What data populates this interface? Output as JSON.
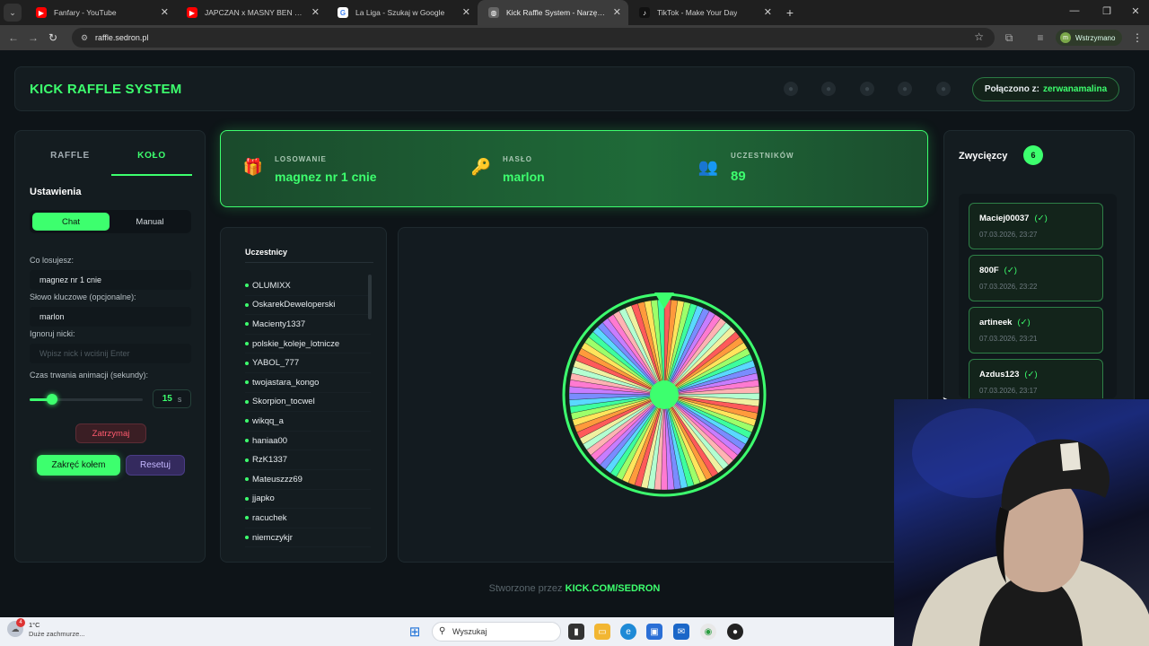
{
  "browser": {
    "tabs": [
      {
        "title": "Fanfary - YouTube",
        "icon": "youtube-icon",
        "color": "#ff0000"
      },
      {
        "title": "JAPCZAN x MASNY BEN - SHA",
        "icon": "youtube-icon",
        "color": "#ff0000"
      },
      {
        "title": "La Liga - Szukaj w Google",
        "icon": "google-icon",
        "color": "#ffffff"
      },
      {
        "title": "Kick Raffle System - Narzędzie d",
        "icon": "globe-icon",
        "color": "#777777"
      },
      {
        "title": "TikTok - Make Your Day",
        "icon": "tiktok-icon",
        "color": "#000000"
      }
    ],
    "active_tab": 3,
    "url": "raffle.sedron.pl",
    "profile_initial": "m",
    "profile_label": "Wstrzymano"
  },
  "header": {
    "brand": "KICK RAFFLE SYSTEM",
    "connected_label": "Połączono z:",
    "connected_user": "zerwanamalina"
  },
  "settings": {
    "tabs": [
      "RAFFLE",
      "KOŁO"
    ],
    "active_tab": "KOŁO",
    "title": "Ustawienia",
    "mode_options": [
      "Chat",
      "Manual"
    ],
    "mode_selected": "Chat",
    "prize_label": "Co losujesz:",
    "prize_value": "magnez nr 1 cnie",
    "keyword_label": "Słowo kluczowe (opcjonalne):",
    "keyword_value": "marlon",
    "ignore_label": "Ignoruj nicki:",
    "ignore_placeholder": "Wpisz nick i wciśnij Enter",
    "duration_label": "Czas trwania animacji (sekundy):",
    "duration_value": "15",
    "duration_unit": "s",
    "duration_fraction": 0.2,
    "stop_label": "Zatrzymaj",
    "spin_label": "Zakręć kołem",
    "reset_label": "Resetuj"
  },
  "info": {
    "draw_label": "LOSOWANIE",
    "draw_value": "magnez nr 1 cnie",
    "password_label": "HASŁO",
    "password_value": "marlon",
    "participants_label": "UCZESTNIKÓW",
    "participants_value": "89"
  },
  "participants": {
    "title": "Uczestnicy",
    "names": [
      "OLUMIXX",
      "OskarekDeweloperski",
      "Macienty1337",
      "polskie_koleje_lotnicze",
      "YABOL_777",
      "twojastara_kongo",
      "Skorpion_tocwel",
      "wikqq_a",
      "haniaa00",
      "RzK1337",
      "Mateuszzz69",
      "jjapko",
      "racuchek",
      "niemczykjr"
    ]
  },
  "wheel": {
    "segments": 89,
    "palette": [
      "#ff5a5a",
      "#ff9a3c",
      "#ffe45c",
      "#9dff6a",
      "#3dff9e",
      "#5ad8ff",
      "#7a8cff",
      "#c77dff",
      "#ff7ad1",
      "#ffb3b3",
      "#b3ffd1",
      "#f0f0a0"
    ]
  },
  "winners": {
    "title": "Zwycięzcy",
    "count": "6",
    "items": [
      {
        "name": "Maciej00037",
        "check": "(✓)",
        "time": "07.03.2026, 23:27"
      },
      {
        "name": "800F",
        "check": "(✓)",
        "time": "07.03.2026, 23:22"
      },
      {
        "name": "artineek",
        "check": "(✓)",
        "time": "07.03.2026, 23:21"
      },
      {
        "name": "Azdus123",
        "check": "(✓)",
        "time": "07.03.2026, 23:17"
      }
    ]
  },
  "footer": {
    "prefix": "Stworzone przez",
    "link": "KICK.COM/SEDRON"
  },
  "taskbar": {
    "weather_temp": "1°C",
    "weather_desc": "Duże zachmurze...",
    "weather_badge": "4",
    "search_placeholder": "Wyszukaj"
  },
  "colors": {
    "accent": "#3dff6e",
    "background": "#0e1418",
    "card": "#141c20"
  }
}
